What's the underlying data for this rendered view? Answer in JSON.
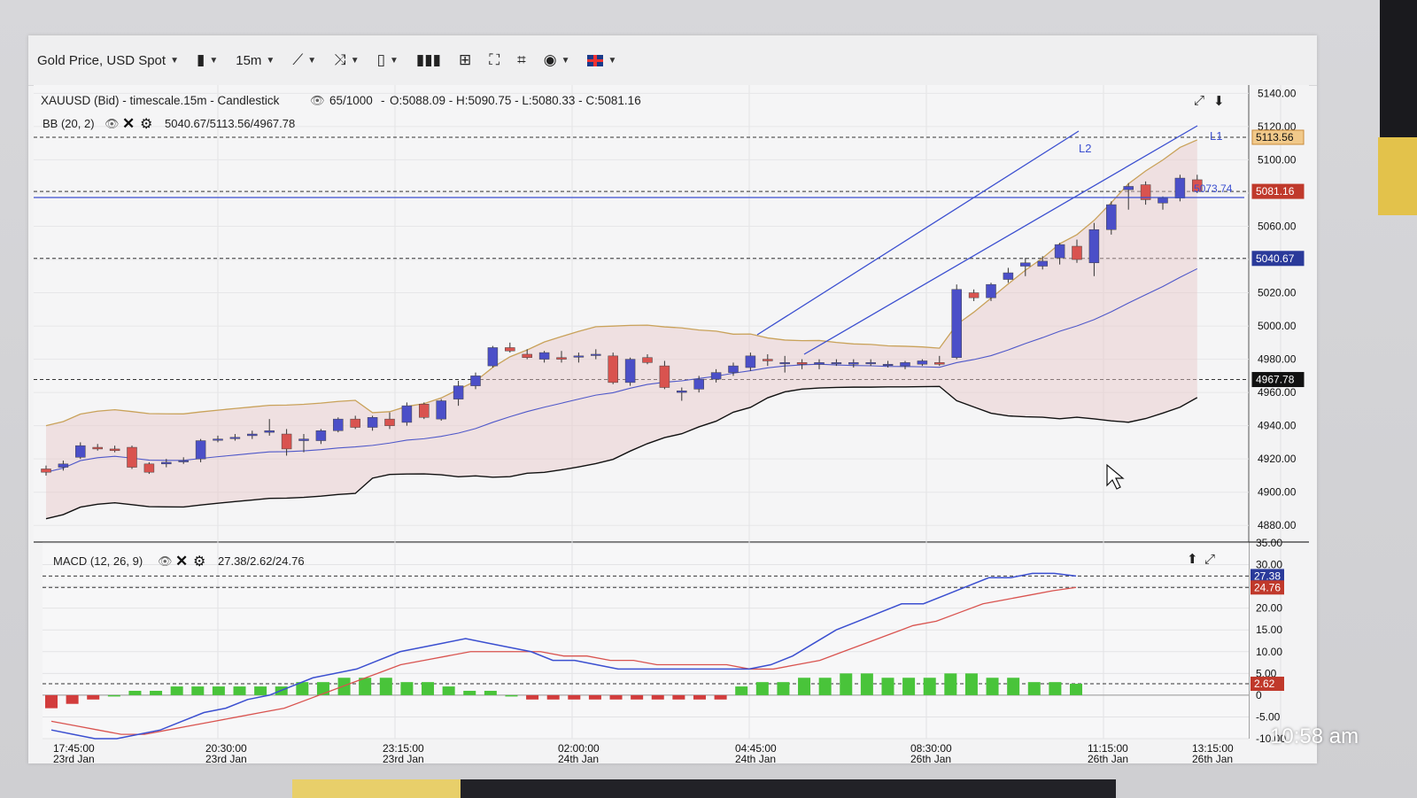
{
  "toolbar": {
    "instrument": "Gold Price, USD Spot",
    "timeframe": "15m"
  },
  "main_panel": {
    "title_line": "XAUUSD (Bid) - timescale.15m - Candlestick",
    "count": "65/1000",
    "ohlc": "O:5088.09 - H:5090.75 - L:5080.33 - C:5081.16",
    "bb_label": "BB (20, 2)",
    "bb_values": "5040.67/5113.56/4967.78",
    "line_label_L1": "L1",
    "line_label_L2": "L2",
    "hline_value": "5073.74",
    "price_axis": [
      "5140.00",
      "5120.00",
      "5100.00",
      "5060.00",
      "5020.00",
      "5000.00",
      "4980.00",
      "4960.00",
      "4940.00",
      "4920.00",
      "4900.00",
      "4880.00"
    ],
    "price_tags": {
      "upper": "5113.56",
      "close": "5081.16",
      "middle": "5040.67",
      "lower": "4967.78"
    },
    "colors": {
      "up": "#4b4fc8",
      "down": "#d9534f",
      "upper_band": "#c9a25a",
      "middle_band": "#4f58c9",
      "lower_band": "#111111",
      "trend": "#3b4fd0",
      "close_tag": "#c0392b",
      "middle_tag": "#2a3a9a",
      "lower_tag": "#111111",
      "upper_tag": "#c98a3a"
    }
  },
  "macd_panel": {
    "label": "MACD (12, 26, 9)",
    "values": "27.38/2.62/24.76",
    "axis": [
      "35.00",
      "30.00",
      "25.00",
      "20.00",
      "15.00",
      "10.00",
      "5.00",
      "0",
      "-5.00",
      "-10.00"
    ],
    "tags": {
      "macd": "27.38",
      "signal": "24.76",
      "hist": "2.62"
    }
  },
  "time_axis": [
    {
      "time": "17:45:00",
      "date": "23rd Jan"
    },
    {
      "time": "20:30:00",
      "date": "23rd Jan"
    },
    {
      "time": "23:15:00",
      "date": "23rd Jan"
    },
    {
      "time": "02:00:00",
      "date": "24th Jan"
    },
    {
      "time": "04:45:00",
      "date": "24th Jan"
    },
    {
      "time": "08:30:00",
      "date": "26th Jan"
    },
    {
      "time": "11:15:00",
      "date": "26th Jan"
    },
    {
      "time": "13:15:00",
      "date": "26th Jan"
    }
  ],
  "status_bar": {
    "clock": "10:58 am"
  },
  "chart_data": {
    "type": "candlestick",
    "instrument": "XAUUSD (Bid)",
    "timeframe": "15m",
    "ylim": [
      4870,
      5145
    ],
    "candles_ohlc": [
      [
        4914,
        4916,
        4910,
        4912
      ],
      [
        4915,
        4919,
        4913,
        4917
      ],
      [
        4921,
        4930,
        4920,
        4928
      ],
      [
        4927,
        4929,
        4925,
        4926
      ],
      [
        4926,
        4928,
        4924,
        4925
      ],
      [
        4927,
        4928,
        4914,
        4915
      ],
      [
        4917,
        4918,
        4911,
        4912
      ],
      [
        4917,
        4920,
        4915,
        4918
      ],
      [
        4919,
        4921,
        4917,
        4919
      ],
      [
        4920,
        4932,
        4918,
        4931
      ],
      [
        4932,
        4934,
        4930,
        4932
      ],
      [
        4933,
        4935,
        4931,
        4933
      ],
      [
        4934,
        4937,
        4932,
        4935
      ],
      [
        4936,
        4944,
        4934,
        4937
      ],
      [
        4935,
        4938,
        4922,
        4926
      ],
      [
        4931,
        4935,
        4924,
        4932
      ],
      [
        4931,
        4938,
        4929,
        4937
      ],
      [
        4937,
        4945,
        4936,
        4944
      ],
      [
        4944,
        4946,
        4938,
        4939
      ],
      [
        4939,
        4946,
        4937,
        4945
      ],
      [
        4944,
        4948,
        4938,
        4940
      ],
      [
        4942,
        4954,
        4940,
        4952
      ],
      [
        4953,
        4954,
        4944,
        4945
      ],
      [
        4944,
        4956,
        4943,
        4955
      ],
      [
        4956,
        4967,
        4952,
        4964
      ],
      [
        4964,
        4972,
        4962,
        4970
      ],
      [
        4976,
        4988,
        4975,
        4987
      ],
      [
        4987,
        4990,
        4984,
        4985
      ],
      [
        4983,
        4986,
        4980,
        4981
      ],
      [
        4980,
        4985,
        4978,
        4984
      ],
      [
        4981,
        4985,
        4978,
        4980
      ],
      [
        4982,
        4984,
        4978,
        4982
      ],
      [
        4983,
        4986,
        4980,
        4983
      ],
      [
        4982,
        4984,
        4965,
        4966
      ],
      [
        4966,
        4981,
        4964,
        4980
      ],
      [
        4981,
        4983,
        4977,
        4978
      ],
      [
        4976,
        4979,
        4962,
        4963
      ],
      [
        4960,
        4963,
        4955,
        4961
      ],
      [
        4962,
        4970,
        4960,
        4968
      ],
      [
        4968,
        4974,
        4966,
        4972
      ],
      [
        4972,
        4978,
        4970,
        4976
      ],
      [
        4975,
        4984,
        4973,
        4982
      ],
      [
        4980,
        4983,
        4976,
        4979
      ],
      [
        4978,
        4982,
        4972,
        4978
      ],
      [
        4978,
        4980,
        4974,
        4977
      ],
      [
        4977,
        4980,
        4974,
        4978
      ],
      [
        4978,
        4980,
        4976,
        4978
      ],
      [
        4977,
        4980,
        4975,
        4978
      ],
      [
        4978,
        4980,
        4976,
        4978
      ],
      [
        4977,
        4979,
        4975,
        4977
      ],
      [
        4976,
        4979,
        4974,
        4978
      ],
      [
        4977,
        4980,
        4976,
        4979
      ],
      [
        4978,
        4982,
        4976,
        4977
      ],
      [
        4981,
        5025,
        4980,
        5022
      ],
      [
        5020,
        5022,
        5015,
        5017
      ],
      [
        5017,
        5026,
        5015,
        5025
      ],
      [
        5028,
        5035,
        5026,
        5032
      ],
      [
        5036,
        5041,
        5030,
        5038
      ],
      [
        5036,
        5042,
        5034,
        5039
      ],
      [
        5041,
        5050,
        5037,
        5049
      ],
      [
        5048,
        5052,
        5038,
        5040
      ],
      [
        5038,
        5062,
        5030,
        5058
      ],
      [
        5058,
        5075,
        5055,
        5073
      ],
      [
        5082,
        5086,
        5070,
        5084
      ],
      [
        5085,
        5087,
        5073,
        5076
      ],
      [
        5074,
        5078,
        5070,
        5077
      ],
      [
        5077,
        5091,
        5075,
        5089
      ],
      [
        5088,
        5091,
        5080,
        5081
      ]
    ],
    "bollinger": {
      "period": 20,
      "stddev": 2,
      "last": {
        "middle": 5040.67,
        "upper": 5113.56,
        "lower": 4967.78
      }
    },
    "horizontal_line": 5073.74,
    "trend_lines": [
      "L1",
      "L2"
    ],
    "macd": {
      "params": [
        12,
        26,
        9
      ],
      "last": {
        "macd": 27.38,
        "histogram": 2.62,
        "signal": 24.76
      },
      "macd_line": [
        -8,
        -9,
        -10,
        -10,
        -9,
        -8,
        -6,
        -4,
        -3,
        -1,
        0,
        2,
        4,
        5,
        6,
        8,
        10,
        11,
        12,
        13,
        12,
        11,
        10,
        8,
        8,
        7,
        6,
        6,
        6,
        6,
        6,
        6,
        6,
        7,
        9,
        12,
        15,
        17,
        19,
        21,
        21,
        23,
        25,
        27,
        27,
        28,
        28,
        27.38
      ],
      "signal_line": [
        -6,
        -7,
        -8,
        -9,
        -9,
        -8,
        -7,
        -6,
        -5,
        -4,
        -3,
        -1,
        1,
        3,
        5,
        7,
        8,
        9,
        10,
        10,
        10,
        10,
        9,
        9,
        8,
        8,
        7,
        7,
        7,
        7,
        6,
        6,
        7,
        8,
        10,
        12,
        14,
        16,
        17,
        19,
        21,
        22,
        23,
        24,
        24.76
      ],
      "histogram": [
        -3,
        -2,
        -1,
        0,
        1,
        1,
        2,
        2,
        2,
        2,
        2,
        2,
        3,
        3,
        4,
        4,
        4,
        3,
        3,
        2,
        1,
        1,
        0,
        -1,
        -1,
        -1,
        -1,
        -1,
        -1,
        -1,
        -1,
        -1,
        -1,
        2,
        3,
        3,
        4,
        4,
        5,
        5,
        4,
        4,
        4,
        5,
        5,
        4,
        4,
        3,
        3,
        2.62
      ]
    }
  }
}
